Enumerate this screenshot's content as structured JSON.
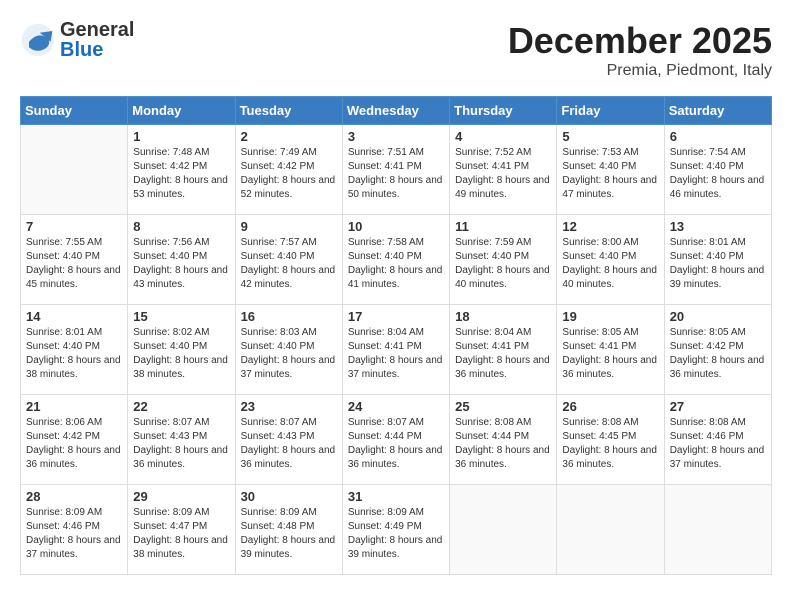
{
  "header": {
    "logo_general": "General",
    "logo_blue": "Blue",
    "month_title": "December 2025",
    "location": "Premia, Piedmont, Italy"
  },
  "days_of_week": [
    "Sunday",
    "Monday",
    "Tuesday",
    "Wednesday",
    "Thursday",
    "Friday",
    "Saturday"
  ],
  "weeks": [
    [
      {
        "day": "",
        "sunrise": "",
        "sunset": "",
        "daylight": ""
      },
      {
        "day": "1",
        "sunrise": "Sunrise: 7:48 AM",
        "sunset": "Sunset: 4:42 PM",
        "daylight": "Daylight: 8 hours and 53 minutes."
      },
      {
        "day": "2",
        "sunrise": "Sunrise: 7:49 AM",
        "sunset": "Sunset: 4:42 PM",
        "daylight": "Daylight: 8 hours and 52 minutes."
      },
      {
        "day": "3",
        "sunrise": "Sunrise: 7:51 AM",
        "sunset": "Sunset: 4:41 PM",
        "daylight": "Daylight: 8 hours and 50 minutes."
      },
      {
        "day": "4",
        "sunrise": "Sunrise: 7:52 AM",
        "sunset": "Sunset: 4:41 PM",
        "daylight": "Daylight: 8 hours and 49 minutes."
      },
      {
        "day": "5",
        "sunrise": "Sunrise: 7:53 AM",
        "sunset": "Sunset: 4:40 PM",
        "daylight": "Daylight: 8 hours and 47 minutes."
      },
      {
        "day": "6",
        "sunrise": "Sunrise: 7:54 AM",
        "sunset": "Sunset: 4:40 PM",
        "daylight": "Daylight: 8 hours and 46 minutes."
      }
    ],
    [
      {
        "day": "7",
        "sunrise": "Sunrise: 7:55 AM",
        "sunset": "Sunset: 4:40 PM",
        "daylight": "Daylight: 8 hours and 45 minutes."
      },
      {
        "day": "8",
        "sunrise": "Sunrise: 7:56 AM",
        "sunset": "Sunset: 4:40 PM",
        "daylight": "Daylight: 8 hours and 43 minutes."
      },
      {
        "day": "9",
        "sunrise": "Sunrise: 7:57 AM",
        "sunset": "Sunset: 4:40 PM",
        "daylight": "Daylight: 8 hours and 42 minutes."
      },
      {
        "day": "10",
        "sunrise": "Sunrise: 7:58 AM",
        "sunset": "Sunset: 4:40 PM",
        "daylight": "Daylight: 8 hours and 41 minutes."
      },
      {
        "day": "11",
        "sunrise": "Sunrise: 7:59 AM",
        "sunset": "Sunset: 4:40 PM",
        "daylight": "Daylight: 8 hours and 40 minutes."
      },
      {
        "day": "12",
        "sunrise": "Sunrise: 8:00 AM",
        "sunset": "Sunset: 4:40 PM",
        "daylight": "Daylight: 8 hours and 40 minutes."
      },
      {
        "day": "13",
        "sunrise": "Sunrise: 8:01 AM",
        "sunset": "Sunset: 4:40 PM",
        "daylight": "Daylight: 8 hours and 39 minutes."
      }
    ],
    [
      {
        "day": "14",
        "sunrise": "Sunrise: 8:01 AM",
        "sunset": "Sunset: 4:40 PM",
        "daylight": "Daylight: 8 hours and 38 minutes."
      },
      {
        "day": "15",
        "sunrise": "Sunrise: 8:02 AM",
        "sunset": "Sunset: 4:40 PM",
        "daylight": "Daylight: 8 hours and 38 minutes."
      },
      {
        "day": "16",
        "sunrise": "Sunrise: 8:03 AM",
        "sunset": "Sunset: 4:40 PM",
        "daylight": "Daylight: 8 hours and 37 minutes."
      },
      {
        "day": "17",
        "sunrise": "Sunrise: 8:04 AM",
        "sunset": "Sunset: 4:41 PM",
        "daylight": "Daylight: 8 hours and 37 minutes."
      },
      {
        "day": "18",
        "sunrise": "Sunrise: 8:04 AM",
        "sunset": "Sunset: 4:41 PM",
        "daylight": "Daylight: 8 hours and 36 minutes."
      },
      {
        "day": "19",
        "sunrise": "Sunrise: 8:05 AM",
        "sunset": "Sunset: 4:41 PM",
        "daylight": "Daylight: 8 hours and 36 minutes."
      },
      {
        "day": "20",
        "sunrise": "Sunrise: 8:05 AM",
        "sunset": "Sunset: 4:42 PM",
        "daylight": "Daylight: 8 hours and 36 minutes."
      }
    ],
    [
      {
        "day": "21",
        "sunrise": "Sunrise: 8:06 AM",
        "sunset": "Sunset: 4:42 PM",
        "daylight": "Daylight: 8 hours and 36 minutes."
      },
      {
        "day": "22",
        "sunrise": "Sunrise: 8:07 AM",
        "sunset": "Sunset: 4:43 PM",
        "daylight": "Daylight: 8 hours and 36 minutes."
      },
      {
        "day": "23",
        "sunrise": "Sunrise: 8:07 AM",
        "sunset": "Sunset: 4:43 PM",
        "daylight": "Daylight: 8 hours and 36 minutes."
      },
      {
        "day": "24",
        "sunrise": "Sunrise: 8:07 AM",
        "sunset": "Sunset: 4:44 PM",
        "daylight": "Daylight: 8 hours and 36 minutes."
      },
      {
        "day": "25",
        "sunrise": "Sunrise: 8:08 AM",
        "sunset": "Sunset: 4:44 PM",
        "daylight": "Daylight: 8 hours and 36 minutes."
      },
      {
        "day": "26",
        "sunrise": "Sunrise: 8:08 AM",
        "sunset": "Sunset: 4:45 PM",
        "daylight": "Daylight: 8 hours and 36 minutes."
      },
      {
        "day": "27",
        "sunrise": "Sunrise: 8:08 AM",
        "sunset": "Sunset: 4:46 PM",
        "daylight": "Daylight: 8 hours and 37 minutes."
      }
    ],
    [
      {
        "day": "28",
        "sunrise": "Sunrise: 8:09 AM",
        "sunset": "Sunset: 4:46 PM",
        "daylight": "Daylight: 8 hours and 37 minutes."
      },
      {
        "day": "29",
        "sunrise": "Sunrise: 8:09 AM",
        "sunset": "Sunset: 4:47 PM",
        "daylight": "Daylight: 8 hours and 38 minutes."
      },
      {
        "day": "30",
        "sunrise": "Sunrise: 8:09 AM",
        "sunset": "Sunset: 4:48 PM",
        "daylight": "Daylight: 8 hours and 39 minutes."
      },
      {
        "day": "31",
        "sunrise": "Sunrise: 8:09 AM",
        "sunset": "Sunset: 4:49 PM",
        "daylight": "Daylight: 8 hours and 39 minutes."
      },
      {
        "day": "",
        "sunrise": "",
        "sunset": "",
        "daylight": ""
      },
      {
        "day": "",
        "sunrise": "",
        "sunset": "",
        "daylight": ""
      },
      {
        "day": "",
        "sunrise": "",
        "sunset": "",
        "daylight": ""
      }
    ]
  ]
}
